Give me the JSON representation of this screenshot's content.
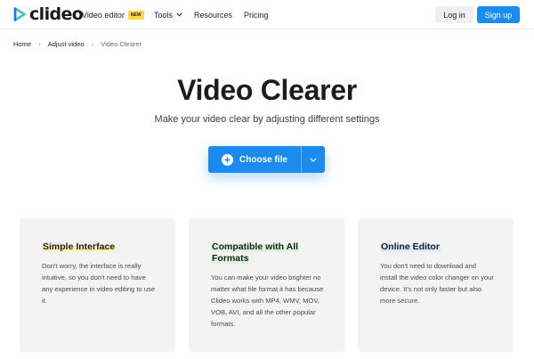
{
  "header": {
    "logo_text": "clideo",
    "nav": {
      "video_editor": "Video editor",
      "new_badge": "NEW",
      "tools": "Tools",
      "resources": "Resources",
      "pricing": "Pricing"
    },
    "login_label": "Log in",
    "signup_label": "Sign up"
  },
  "breadcrumb": {
    "home": "Home",
    "adjust_video": "Adjust video",
    "current": "Video Clearer"
  },
  "hero": {
    "title": "Video Clearer",
    "subtitle": "Make your video clear by adjusting different settings",
    "choose_label": "Choose file"
  },
  "cards": [
    {
      "title": "Simple Interface",
      "text": "Don't worry, the interface is really intuitive, so you don't need to have any experience in video editing to use it."
    },
    {
      "title": "Compatible with All Formats",
      "text": "You can make your video brighter no matter what file format it has because Clideo works with MP4, WMV, MOV, VOB, AVI, and all the other popular formats."
    },
    {
      "title": "Online Editor",
      "text": "You don't need to download and install the video color changer on your device. It's not only faster but also more secure."
    }
  ],
  "colors": {
    "brand_blue": "#1b8bf0",
    "logo_teal": "#3cc7c5",
    "badge_yellow": "#ffd644",
    "card_bg": "#f3f3f4"
  },
  "icons": [
    "clideo-logo-icon",
    "chevron-down-icon",
    "chevron-right-icon",
    "plus-circle-icon"
  ]
}
